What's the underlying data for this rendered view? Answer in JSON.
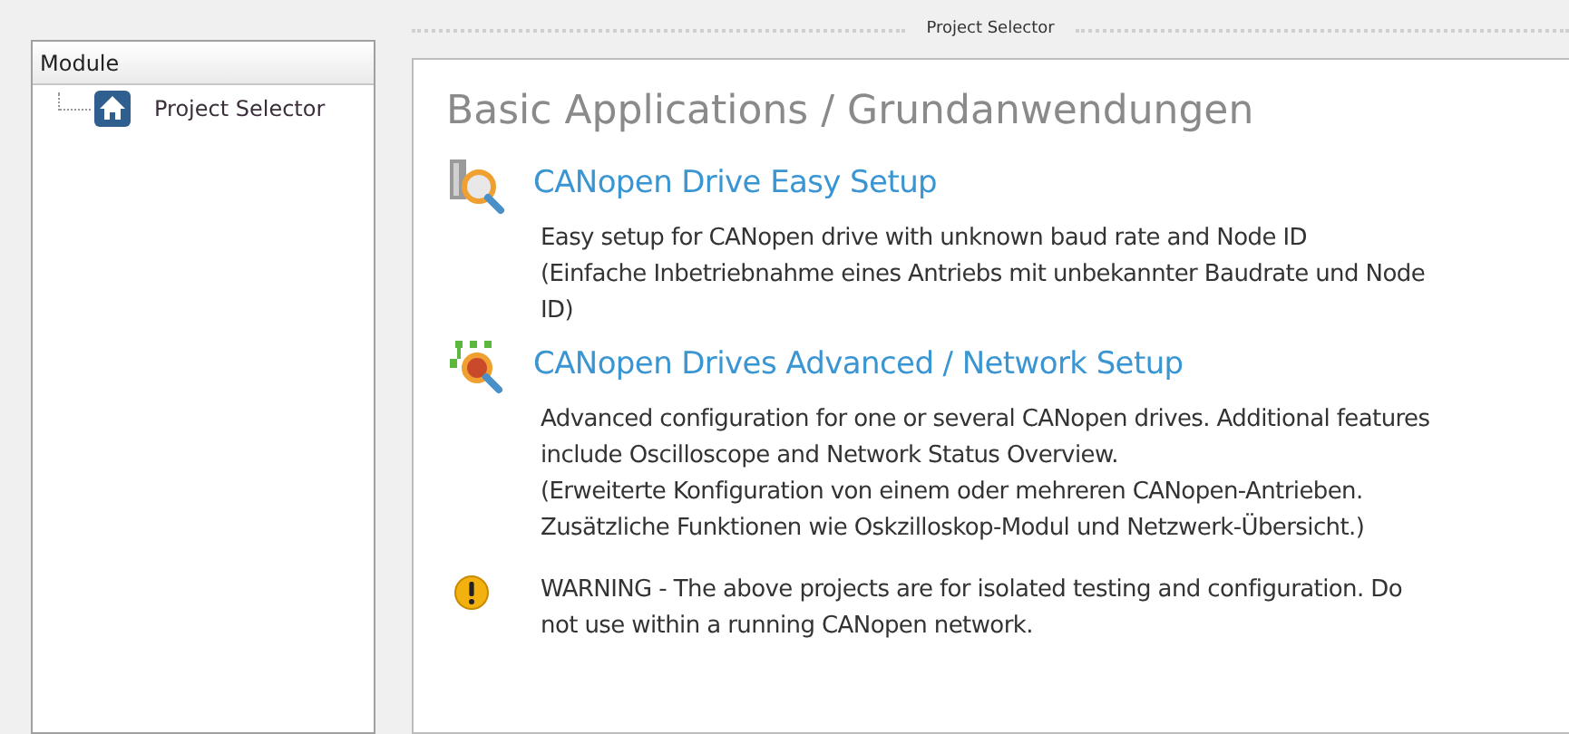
{
  "sidebar": {
    "header": "Module",
    "items": [
      {
        "label": "Project Selector",
        "selected": false
      }
    ]
  },
  "panel": {
    "title": "Project Selector",
    "heading": "Basic Applications / Grundanwendungen",
    "entries": [
      {
        "kind": "easy",
        "title": "CANopen Drive Easy Setup",
        "lines": [
          "Easy setup for CANopen drive with unknown baud rate and Node ID",
          "(Einfache Inbetriebnahme eines Antriebs mit unbekannter Baudrate und Node",
          "ID)"
        ]
      },
      {
        "kind": "advanced",
        "title": "CANopen Drives Advanced / Network Setup",
        "lines": [
          "Advanced configuration for one or several CANopen drives. Additional features",
          "include Oscilloscope and Network Status Overview.",
          "(Erweiterte Konfiguration von einem oder mehreren CANopen-Antrieben.",
          "Zusätzliche Funktionen wie Oskzilloskop-Modul und Netzwerk-Übersicht.)"
        ]
      },
      {
        "kind": "warning",
        "lines": [
          "WARNING - The above projects are for isolated testing and configuration. Do",
          "not use within a running CANopen network."
        ]
      }
    ]
  }
}
